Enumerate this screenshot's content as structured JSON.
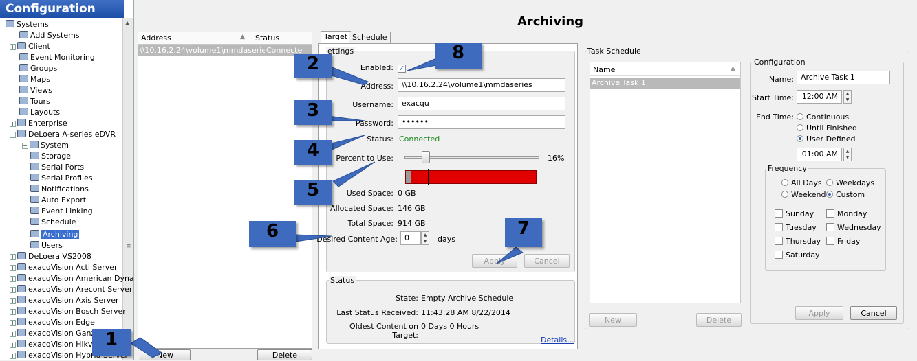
{
  "tree": {
    "title": "Configuration",
    "items": [
      {
        "label": "Systems"
      },
      {
        "label": "Add Systems"
      },
      {
        "label": "Client"
      },
      {
        "label": "Event Monitoring"
      },
      {
        "label": "Groups"
      },
      {
        "label": "Maps"
      },
      {
        "label": "Views"
      },
      {
        "label": "Tours"
      },
      {
        "label": "Layouts"
      },
      {
        "label": "Enterprise"
      },
      {
        "label": "DeLoera A-series eDVR"
      },
      {
        "label": "System"
      },
      {
        "label": "Storage"
      },
      {
        "label": "Serial Ports"
      },
      {
        "label": "Serial Profiles"
      },
      {
        "label": "Notifications"
      },
      {
        "label": "Auto Export"
      },
      {
        "label": "Event Linking"
      },
      {
        "label": "Schedule"
      },
      {
        "label": "Archiving"
      },
      {
        "label": "Users"
      },
      {
        "label": "DeLoera VS2008"
      },
      {
        "label": "exacqVision Acti Server"
      },
      {
        "label": "exacqVision American Dyna"
      },
      {
        "label": "exacqVision Arecont Server"
      },
      {
        "label": "exacqVision Axis Server"
      },
      {
        "label": "exacqVision Bosch Server"
      },
      {
        "label": "exacqVision Edge"
      },
      {
        "label": "exacqVision Ganz"
      },
      {
        "label": "exacqVision Hikvis"
      },
      {
        "label": "exacqVision Hybrid Server"
      }
    ]
  },
  "page_title": "Archiving",
  "address_list": {
    "col_address": "Address",
    "col_status": "Status",
    "rows": [
      {
        "address": "\\\\10.16.2.24\\volume1\\mmdaseries",
        "status": "Connecte"
      }
    ],
    "new_button": "New",
    "delete_button": "Delete"
  },
  "tabs": {
    "target": "Target",
    "schedule": "Schedule"
  },
  "settings": {
    "legend": "ettings",
    "enabled_label": "Enabled:",
    "address_label": "Address:",
    "address_value": "\\\\10.16.2.24\\volume1\\mmdaseries",
    "username_label": "Username:",
    "username_value": "exacqu",
    "password_label": "Password:",
    "password_value": "••••••",
    "status_label": "Status:",
    "status_value": "Connected",
    "percent_label": "Percent to Use:",
    "percent_value": "16%",
    "percent_fraction": 0.16,
    "used_label": "Used Space:",
    "used_value": "0 GB",
    "allocated_label": "Allocated Space:",
    "allocated_value": "146 GB",
    "total_label": "Total Space:",
    "total_value": "914 GB",
    "age_label": "Desired Content Age:",
    "age_value": "0",
    "age_unit": "days",
    "apply_button": "Apply",
    "cancel_button": "Cancel"
  },
  "status": {
    "legend": "Status",
    "state_label": "State:",
    "state_value": "Empty Archive Schedule",
    "received_label": "Last Status Received:",
    "received_value": "11:43:28 AM 8/22/2014",
    "oldest_label": "Oldest Content on Target:",
    "oldest_value": "0 Days 0 Hours",
    "details_link": "Details..."
  },
  "task_schedule": {
    "legend": "Task Schedule",
    "col_name": "Name",
    "rows": [
      "Archive Task 1"
    ],
    "new_button": "New",
    "delete_button": "Delete"
  },
  "configuration": {
    "legend": "Configuration",
    "name_label": "Name:",
    "name_value": "Archive Task 1",
    "start_label": "Start Time:",
    "start_value": "12:00 AM",
    "end_label": "End Time:",
    "end_options": [
      "Continuous",
      "Until Finished",
      "User Defined"
    ],
    "end_selected": "User Defined",
    "end_time_value": "01:00 AM",
    "frequency_legend": "Frequency",
    "freq_options": [
      "All Days",
      "Weekdays",
      "Weekend",
      "Custom"
    ],
    "freq_selected": "Custom",
    "days": [
      "Sunday",
      "Monday",
      "Tuesday",
      "Wednesday",
      "Thursday",
      "Friday",
      "Saturday"
    ],
    "apply_button": "Apply",
    "cancel_button": "Cancel"
  },
  "callouts": [
    "1",
    "2",
    "3",
    "4",
    "5",
    "6",
    "7",
    "8"
  ],
  "colors": {
    "accent": "#3e6bbd",
    "connected": "#1f8a1f",
    "bar": "#e00000",
    "selection": "#3a6fd0"
  }
}
